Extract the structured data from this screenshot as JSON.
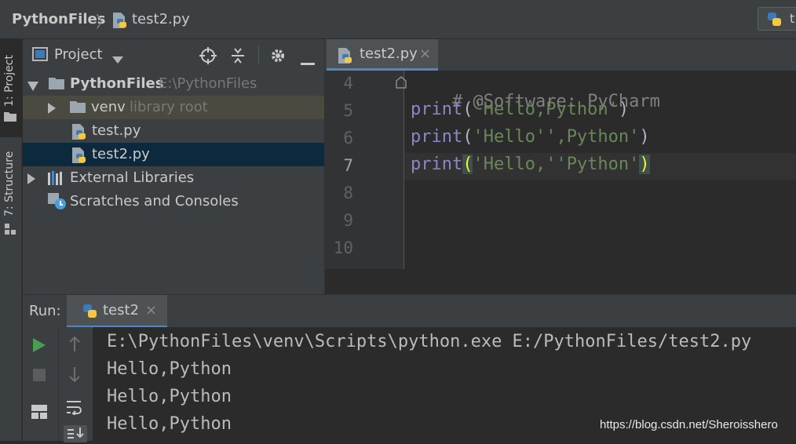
{
  "navbar": {
    "root": "PythonFiles",
    "separator": "〉",
    "file": "test2.py",
    "run_config_label": "t"
  },
  "tool_stripe": {
    "project_label": "1: Project",
    "structure_label": "7: Structure"
  },
  "project_panel": {
    "title": "Project",
    "tree": [
      {
        "label": "PythonFiles",
        "hint": "E:\\PythonFiles"
      },
      {
        "label": "venv",
        "hint": "library root"
      },
      {
        "label": "test.py"
      },
      {
        "label": "test2.py"
      },
      {
        "label": "External Libraries"
      },
      {
        "label": "Scratches and Consoles"
      }
    ]
  },
  "editor": {
    "tab_label": "test2.py",
    "tab_close": "×",
    "line_numbers": [
      "4",
      "5",
      "6",
      "7",
      "8",
      "9",
      "10"
    ],
    "code": {
      "line4_comment": "# @Software: PyCharm",
      "line5_func": "print",
      "line5_open": "(",
      "line5_str": "'Hello,Python'",
      "line5_close": ")",
      "line6_func": "print",
      "line6_open": "(",
      "line6_str": "'Hello'',Python'",
      "line6_close": ")",
      "line7_func": "print",
      "line7_open": "(",
      "line7_str": "'Hello,''Python'",
      "line7_close": ")"
    }
  },
  "run": {
    "label": "Run:",
    "tab_label": "test2",
    "tab_close": "×",
    "console_lines": [
      "E:\\PythonFiles\\venv\\Scripts\\python.exe E:/PythonFiles/test2.py",
      "Hello,Python",
      "Hello,Python",
      "Hello,Python"
    ]
  },
  "watermark": "https://blog.csdn.net/Sheroisshero",
  "colors": {
    "background": "#2b2b2b",
    "panel": "#3c3f41",
    "selection": "#0d293e",
    "string": "#6a8759",
    "builtin": "#8888c6",
    "comment": "#808080",
    "run_green": "#499c54"
  }
}
